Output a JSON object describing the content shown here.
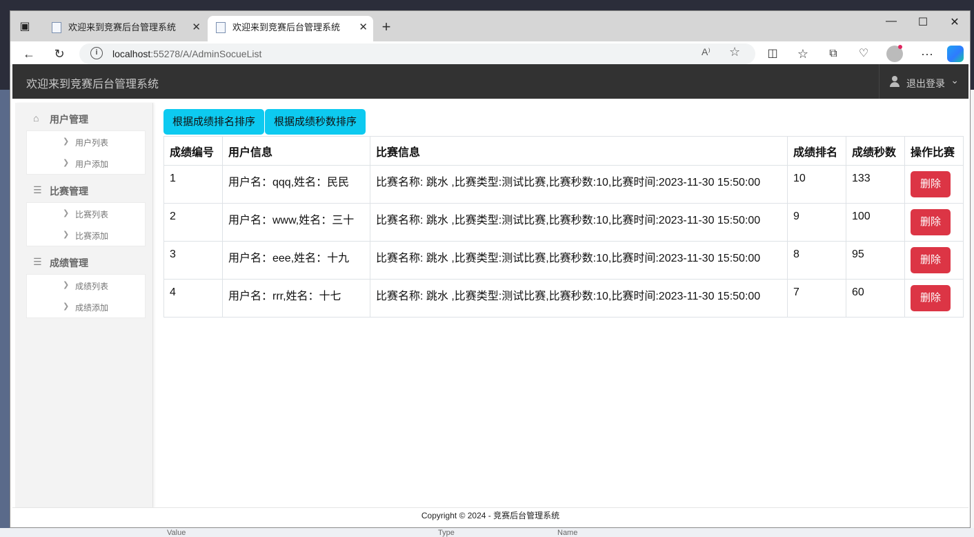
{
  "browser": {
    "tabs": [
      {
        "title": "欢迎来到竞赛后台管理系统",
        "active": false
      },
      {
        "title": "欢迎来到竞赛后台管理系统",
        "active": true
      }
    ],
    "url_host": "localhost",
    "url_path": ":55278/A/AdminSocueList"
  },
  "header": {
    "brand": "欢迎来到竞赛后台管理系统",
    "logout_label": "退出登录"
  },
  "sidebar": {
    "groups": [
      {
        "title": "用户管理",
        "icon": "home-icon",
        "items": [
          "用户列表",
          "用户添加"
        ]
      },
      {
        "title": "比赛管理",
        "icon": "list-icon",
        "items": [
          "比赛列表",
          "比赛添加"
        ]
      },
      {
        "title": "成绩管理",
        "icon": "list-icon",
        "items": [
          "成绩列表",
          "成绩添加"
        ]
      }
    ]
  },
  "main": {
    "sort_by_rank_label": "根据成绩排名排序",
    "sort_by_seconds_label": "根据成绩秒数排序",
    "table": {
      "headers": [
        "成绩编号",
        "用户信息",
        "比赛信息",
        "成绩排名",
        "成绩秒数",
        "操作比赛"
      ],
      "rows": [
        {
          "id": "1",
          "user": "用户名：qqq,姓名：民民",
          "match": "比赛名称: 跳水 ,比赛类型:测试比赛,比赛秒数:10,比赛时间:2023-11-30 15:50:00",
          "rank": "10",
          "seconds": "133",
          "action": "删除"
        },
        {
          "id": "2",
          "user": "用户名：www,姓名：三十",
          "match": "比赛名称: 跳水 ,比赛类型:测试比赛,比赛秒数:10,比赛时间:2023-11-30 15:50:00",
          "rank": "9",
          "seconds": "100",
          "action": "删除"
        },
        {
          "id": "3",
          "user": "用户名：eee,姓名：十九",
          "match": "比赛名称: 跳水 ,比赛类型:测试比赛,比赛秒数:10,比赛时间:2023-11-30 15:50:00",
          "rank": "8",
          "seconds": "95",
          "action": "删除"
        },
        {
          "id": "4",
          "user": "用户名：rrr,姓名：十七",
          "match": "比赛名称: 跳水 ,比赛类型:测试比赛,比赛秒数:10,比赛时间:2023-11-30 15:50:00",
          "rank": "7",
          "seconds": "60",
          "action": "删除"
        }
      ]
    }
  },
  "footer": {
    "text": "Copyright © 2024 - 竞赛后台管理系统"
  },
  "desktop": {
    "bottom_labels": [
      "Value",
      "Type",
      "Name"
    ]
  },
  "colors": {
    "header_bg": "#323232",
    "info_button": "#0dcaf0",
    "danger_button": "#dc3545",
    "sidebar_bg": "#f3f3f3"
  }
}
